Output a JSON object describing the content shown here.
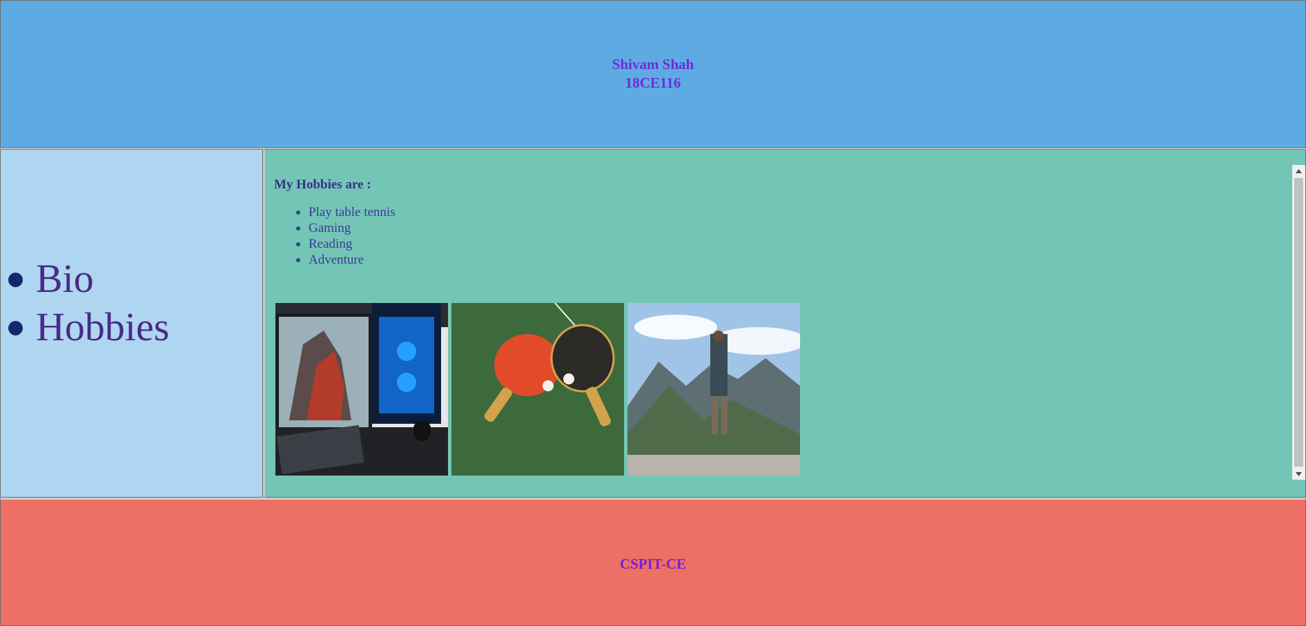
{
  "header": {
    "name": "Shivam Shah",
    "id": "18CE116"
  },
  "sidebar": {
    "items": [
      {
        "label": "Bio"
      },
      {
        "label": "Hobbies"
      }
    ]
  },
  "main": {
    "heading": "My Hobbies are :",
    "hobbies": [
      "Play table tennis",
      "Gaming",
      "Reading",
      "Adventure"
    ],
    "images": [
      {
        "icon": "gaming-pc-photo"
      },
      {
        "icon": "table-tennis-photo"
      },
      {
        "icon": "mountain-hiker-photo"
      }
    ]
  },
  "footer": {
    "text": "CSPIT-CE"
  },
  "colors": {
    "header_bg": "#5DABE2",
    "sidebar_bg": "#AED6F1",
    "main_bg": "#73C6B6",
    "footer_bg": "#EC7063",
    "heading_text": "#6C2BD9"
  }
}
